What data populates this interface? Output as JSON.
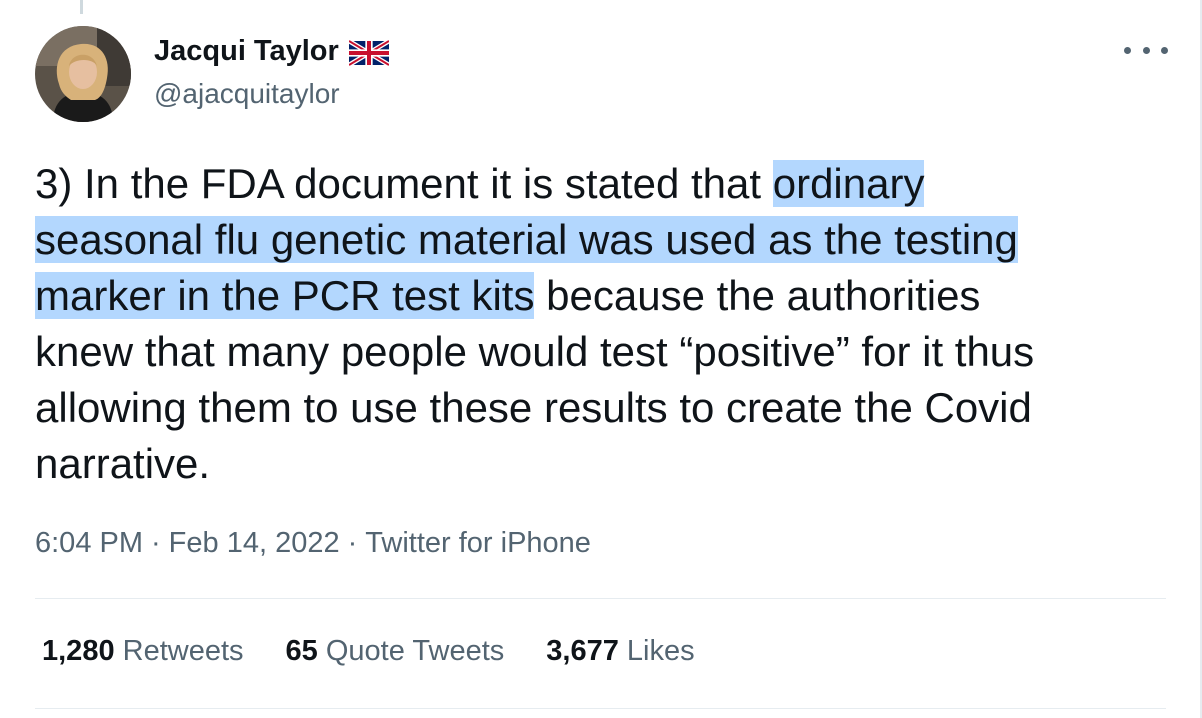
{
  "author": {
    "name": "Jacqui Taylor",
    "handle": "@ajacquitaylor",
    "flag": "uk-flag-icon"
  },
  "tweet": {
    "lines": [
      {
        "pre": "3) In the FDA document it is stated that ",
        "hl": "ordinary",
        "post": ""
      },
      {
        "pre": "",
        "hl": "seasonal flu genetic material was used as the testing",
        "post": ""
      },
      {
        "pre": "",
        "hl": "marker in the PCR test kits",
        "post": " because the authorities"
      },
      {
        "pre": "knew that many people would test “positive” for it thus",
        "hl": "",
        "post": ""
      },
      {
        "pre": "allowing them to use these results to create the Covid",
        "hl": "",
        "post": ""
      },
      {
        "pre": "narrative.",
        "hl": "",
        "post": ""
      }
    ]
  },
  "meta": {
    "time": "6:04 PM",
    "date": "Feb 14, 2022",
    "source": "Twitter for iPhone",
    "separator": "·"
  },
  "stats": {
    "retweets_count": "1,280",
    "retweets_label": "Retweets",
    "quotes_count": "65",
    "quotes_label": "Quote Tweets",
    "likes_count": "3,677",
    "likes_label": "Likes"
  },
  "colors": {
    "highlight": "#b3d7fe",
    "secondary_text": "#536471",
    "primary_text": "#0f1419"
  }
}
